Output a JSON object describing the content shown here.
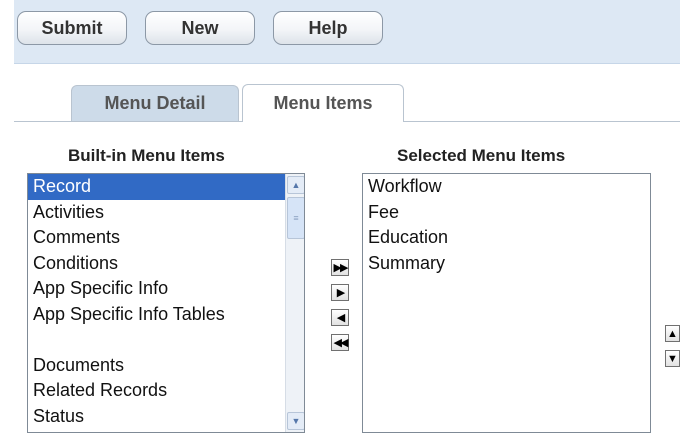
{
  "toolbar": {
    "buttons": [
      {
        "label": "Submit"
      },
      {
        "label": "New"
      },
      {
        "label": "Help"
      }
    ]
  },
  "tabs": [
    {
      "label": "Menu Detail",
      "active": false
    },
    {
      "label": "Menu Items",
      "active": true
    }
  ],
  "builtin": {
    "heading": "Built-in Menu Items",
    "items": [
      "Record",
      "Activities",
      "Comments",
      "Conditions",
      "App Specific Info",
      "App Specific Info Tables",
      "",
      "Documents",
      "Related Records",
      "Status"
    ],
    "selected_index": 0
  },
  "selected_list": {
    "heading": "Selected Menu Items",
    "items": [
      "Workflow",
      "Fee",
      "Education",
      "Summary"
    ]
  },
  "move_buttons": {
    "add_all": "▶▶",
    "add": "▶",
    "remove": "◀",
    "remove_all": "◀◀"
  },
  "order_buttons": {
    "up": "▲",
    "down": "▼"
  },
  "scrollbar": {
    "up": "▲",
    "down": "▼",
    "grip": "≡"
  }
}
